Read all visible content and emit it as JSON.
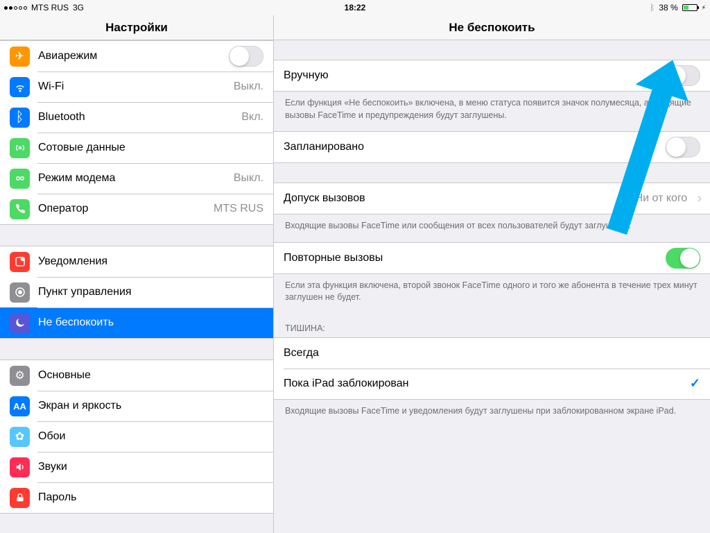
{
  "statusbar": {
    "carrier": "MTS RUS",
    "network": "3G",
    "time": "18:22",
    "battery_pct": "38 %",
    "bluetooth": "✱",
    "charging": "⚡︎"
  },
  "sidebar": {
    "title": "Настройки",
    "groups": [
      [
        {
          "icon": "airplane-icon",
          "bg": "#ff9500",
          "glyph": "✈",
          "label": "Авиарежим",
          "toggle": false
        },
        {
          "icon": "wifi-icon",
          "bg": "#007aff",
          "glyph": "ᯤ",
          "label": "Wi-Fi",
          "detail": "Выкл."
        },
        {
          "icon": "bluetooth-icon",
          "bg": "#007aff",
          "glyph": "ᛒ",
          "label": "Bluetooth",
          "detail": "Вкл."
        },
        {
          "icon": "cellular-icon",
          "bg": "#4cd964",
          "glyph": "⟟",
          "label": "Сотовые данные"
        },
        {
          "icon": "hotspot-icon",
          "bg": "#4cd964",
          "glyph": "☍",
          "label": "Режим модема",
          "detail": "Выкл."
        },
        {
          "icon": "carrier-icon",
          "bg": "#4cd964",
          "glyph": "✆",
          "label": "Оператор",
          "detail": "MTS RUS"
        }
      ],
      [
        {
          "icon": "notifications-icon",
          "bg": "#ff3b30",
          "glyph": "◻",
          "label": "Уведомления"
        },
        {
          "icon": "control-center-icon",
          "bg": "#8e8e93",
          "glyph": "◉",
          "label": "Пункт управления"
        },
        {
          "icon": "dnd-icon",
          "bg": "#5856d6",
          "glyph": "☾",
          "label": "Не беспокоить",
          "selected": true
        }
      ],
      [
        {
          "icon": "general-icon",
          "bg": "#8e8e93",
          "glyph": "⚙",
          "label": "Основные"
        },
        {
          "icon": "display-icon",
          "bg": "#007aff",
          "glyph": "Aᴀ",
          "label": "Экран и яркость"
        },
        {
          "icon": "wallpaper-icon",
          "bg": "#54c7fc",
          "glyph": "✾",
          "label": "Обои"
        },
        {
          "icon": "sounds-icon",
          "bg": "#ff2d55",
          "glyph": "🔊",
          "label": "Звуки"
        },
        {
          "icon": "passcode-icon",
          "bg": "#ff3b30",
          "glyph": "🔒",
          "label": "Пароль"
        }
      ]
    ]
  },
  "main": {
    "title": "Не беспокоить",
    "manual": {
      "label": "Вручную",
      "on": false
    },
    "manual_footer": "Если функция «Не беспокоить» включена, в меню статуса появится значок полумесяца, а входящие вызовы FaceTime и предупреждения будут заглушены.",
    "scheduled": {
      "label": "Запланировано",
      "on": false
    },
    "allow_calls": {
      "label": "Допуск вызовов",
      "value": "Ни от кого"
    },
    "allow_calls_footer": "Входящие вызовы FaceTime или сообщения от всех пользователей будут заглушены.",
    "repeated": {
      "label": "Повторные вызовы",
      "on": true
    },
    "repeated_footer": "Если эта функция включена, второй звонок FaceTime одного и того же абонента в течение трех минут заглушен не будет.",
    "silence_header": "ТИШИНА:",
    "silence_options": [
      {
        "label": "Всегда",
        "checked": false
      },
      {
        "label": "Пока iPad заблокирован",
        "checked": true
      }
    ],
    "silence_footer": "Входящие вызовы FaceTime и уведомления будут заглушены при заблокированном экране iPad."
  }
}
